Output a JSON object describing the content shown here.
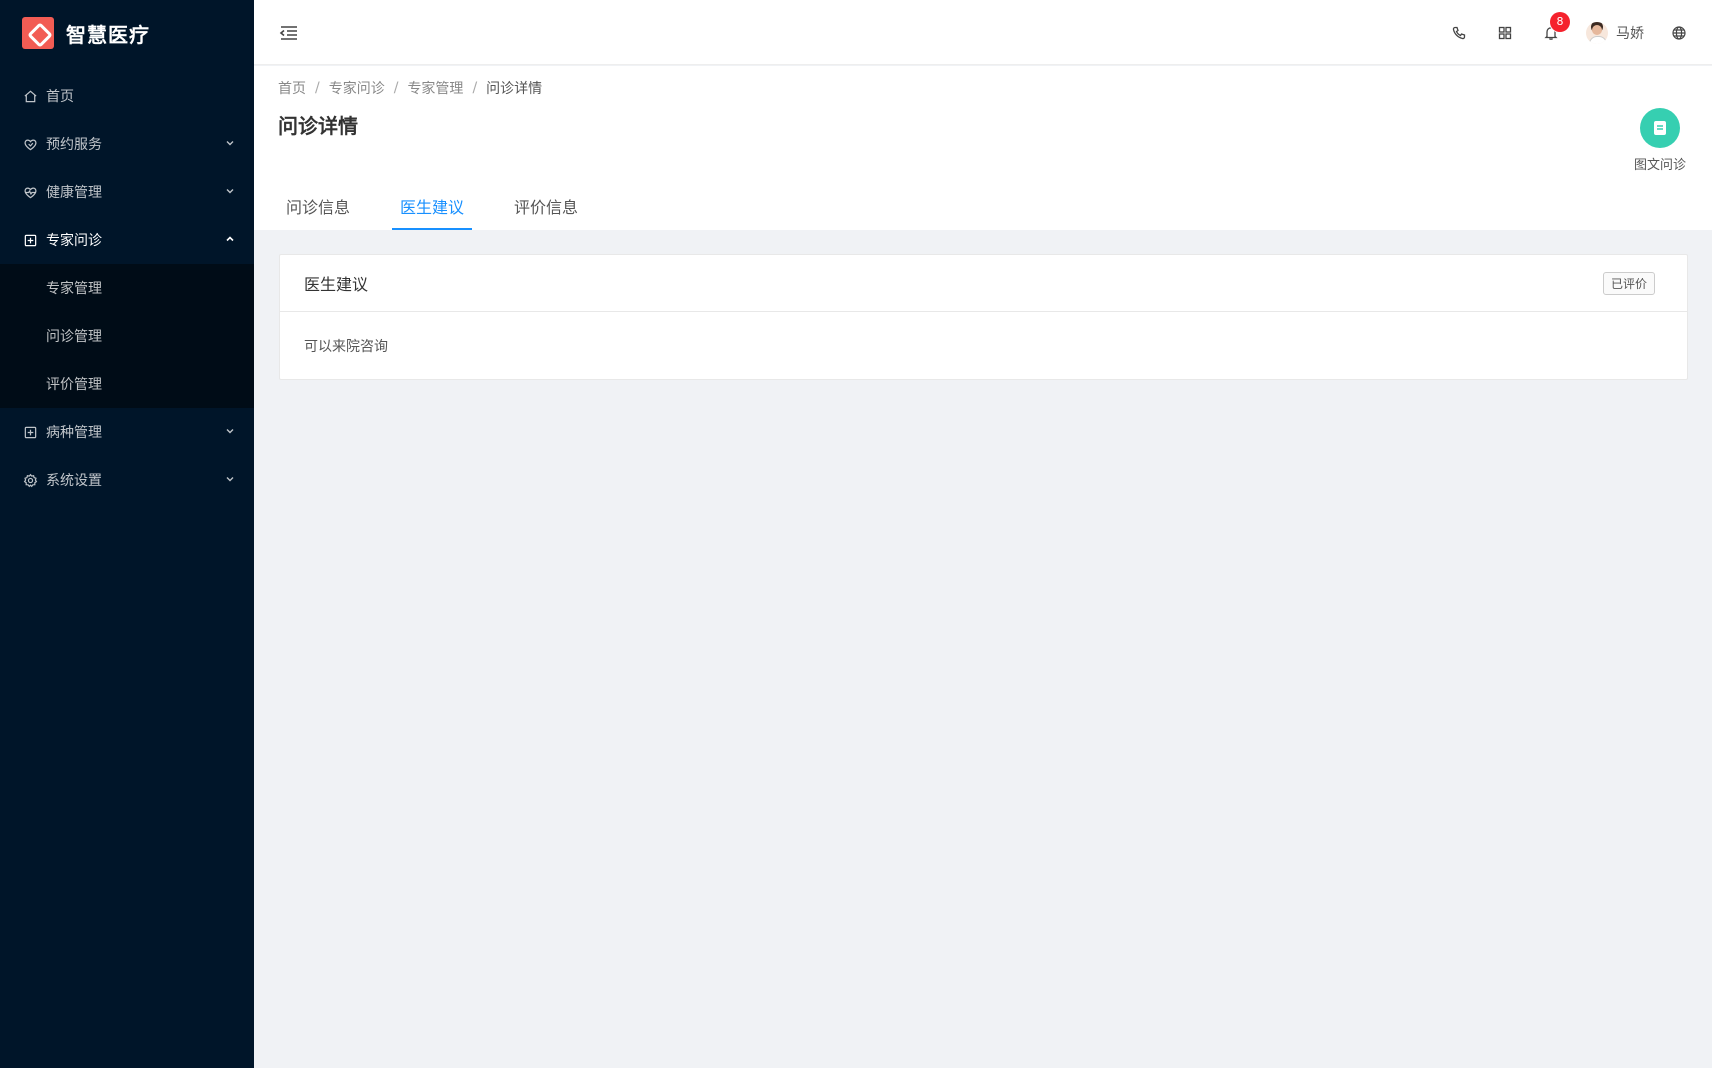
{
  "app": {
    "name": "智慧医疗"
  },
  "sidebar": {
    "items": [
      {
        "label": "首页",
        "icon": "home-icon"
      },
      {
        "label": "预约服务",
        "icon": "heart-icon"
      },
      {
        "label": "健康管理",
        "icon": "heartbeat-icon"
      },
      {
        "label": "专家问诊",
        "icon": "medical-icon",
        "open": true,
        "children": [
          {
            "label": "专家管理"
          },
          {
            "label": "问诊管理"
          },
          {
            "label": "评价管理"
          }
        ]
      },
      {
        "label": "病种管理",
        "icon": "medical-icon"
      },
      {
        "label": "系统设置",
        "icon": "gear-icon"
      }
    ]
  },
  "header": {
    "notification_count": "8",
    "username": "马娇"
  },
  "breadcrumb": [
    "首页",
    "专家问诊",
    "专家管理",
    "问诊详情"
  ],
  "page": {
    "title": "问诊详情",
    "quick_action_label": "图文问诊",
    "tabs": [
      "问诊信息",
      "医生建议",
      "评价信息"
    ],
    "active_tab": "医生建议"
  },
  "card": {
    "title": "医生建议",
    "status_tag": "已评价",
    "content": "可以来院咨询"
  },
  "colors": {
    "sidebar_bg": "#001529",
    "accent": "#1890ff",
    "logo": "#f25c54",
    "quick_action": "#36cfb1",
    "badge": "#f5222d"
  }
}
